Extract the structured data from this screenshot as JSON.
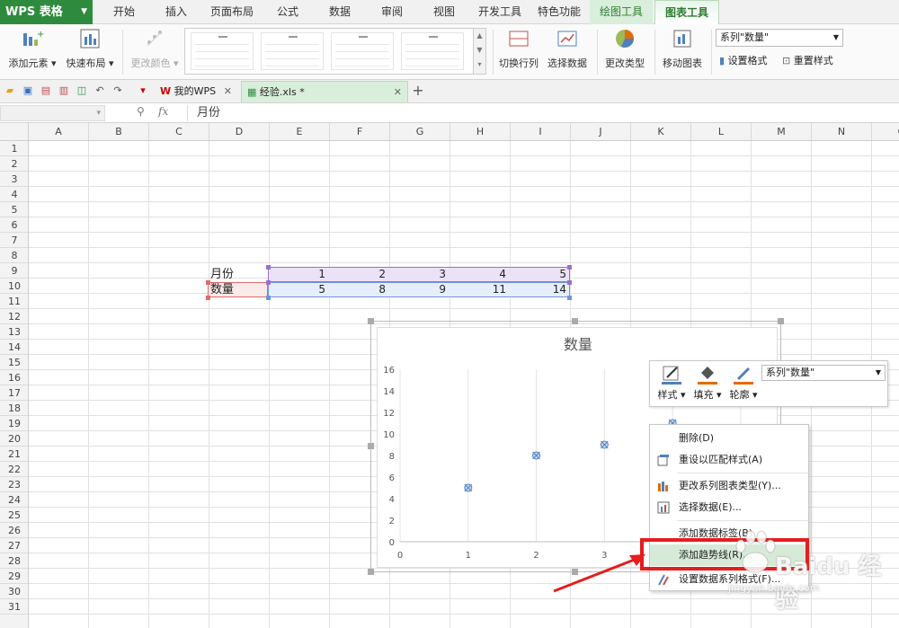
{
  "menubar": {
    "app_label": "WPS 表格",
    "tabs": [
      "开始",
      "插入",
      "页面布局",
      "公式",
      "数据",
      "审阅",
      "视图",
      "开发工具",
      "特色功能",
      "绘图工具",
      "图表工具"
    ]
  },
  "ribbon": {
    "add_element": "添加元素",
    "quick_layout": "快速布局",
    "change_color": "更改颜色",
    "switch_row_col": "切换行列",
    "select_data": "选择数据",
    "change_type": "更改类型",
    "move_chart": "移动图表",
    "series_select": "系列\"数量\"",
    "set_format": "设置格式",
    "reset_style": "重置样式"
  },
  "doctabs": [
    {
      "label": "我的WPS",
      "active": false
    },
    {
      "label": "经验.xls *",
      "active": true
    }
  ],
  "formula_bar": {
    "fx": "fx",
    "content": "月份"
  },
  "columns": [
    "A",
    "B",
    "C",
    "D",
    "E",
    "F",
    "G",
    "H",
    "I",
    "J",
    "K",
    "L",
    "M",
    "N",
    "O"
  ],
  "rows": [
    "1",
    "2",
    "3",
    "4",
    "5",
    "6",
    "7",
    "8",
    "9",
    "10",
    "11",
    "12",
    "13",
    "14",
    "15",
    "16",
    "17",
    "18",
    "19",
    "20",
    "21",
    "22",
    "23",
    "24",
    "25",
    "26",
    "27",
    "28",
    "29",
    "30",
    "31"
  ],
  "sheet": {
    "row9": {
      "label": "月份",
      "values": [
        "1",
        "2",
        "3",
        "4",
        "5"
      ]
    },
    "row10": {
      "label": "数量",
      "values": [
        "5",
        "8",
        "9",
        "11",
        "14"
      ]
    }
  },
  "chart_data": {
    "type": "scatter",
    "title": "数量",
    "x": [
      1,
      2,
      3,
      4,
      5
    ],
    "series": [
      {
        "name": "数量",
        "values": [
          5,
          8,
          9,
          11,
          14
        ]
      }
    ],
    "xlim": [
      0,
      4
    ],
    "ylim": [
      0,
      16
    ],
    "x_ticks": [
      "0",
      "1",
      "2",
      "3"
    ],
    "y_ticks": [
      "0",
      "2",
      "4",
      "6",
      "8",
      "10",
      "12",
      "14",
      "16"
    ],
    "grid": "vertical",
    "marker_color": "#4f81bd"
  },
  "mini_toolbar": {
    "style": "样式",
    "fill": "填充",
    "outline": "轮廓",
    "series_select": "系列\"数量\""
  },
  "context_menu": {
    "items": [
      "删除(D)",
      "重设以匹配样式(A)",
      "更改系列图表类型(Y)...",
      "选择数据(E)...",
      "添加数据标签(B)",
      "添加趋势线(R)...",
      "设置数据系列格式(F)..."
    ],
    "highlighted": "添加趋势线(R)..."
  },
  "watermark": {
    "brand": "Baidu 经验",
    "url": "jingyan.baidu.com"
  },
  "colors": {
    "accent": "#2e8b3d",
    "highlight_box": "#e51d1d",
    "arrow": "#e51d1d"
  }
}
